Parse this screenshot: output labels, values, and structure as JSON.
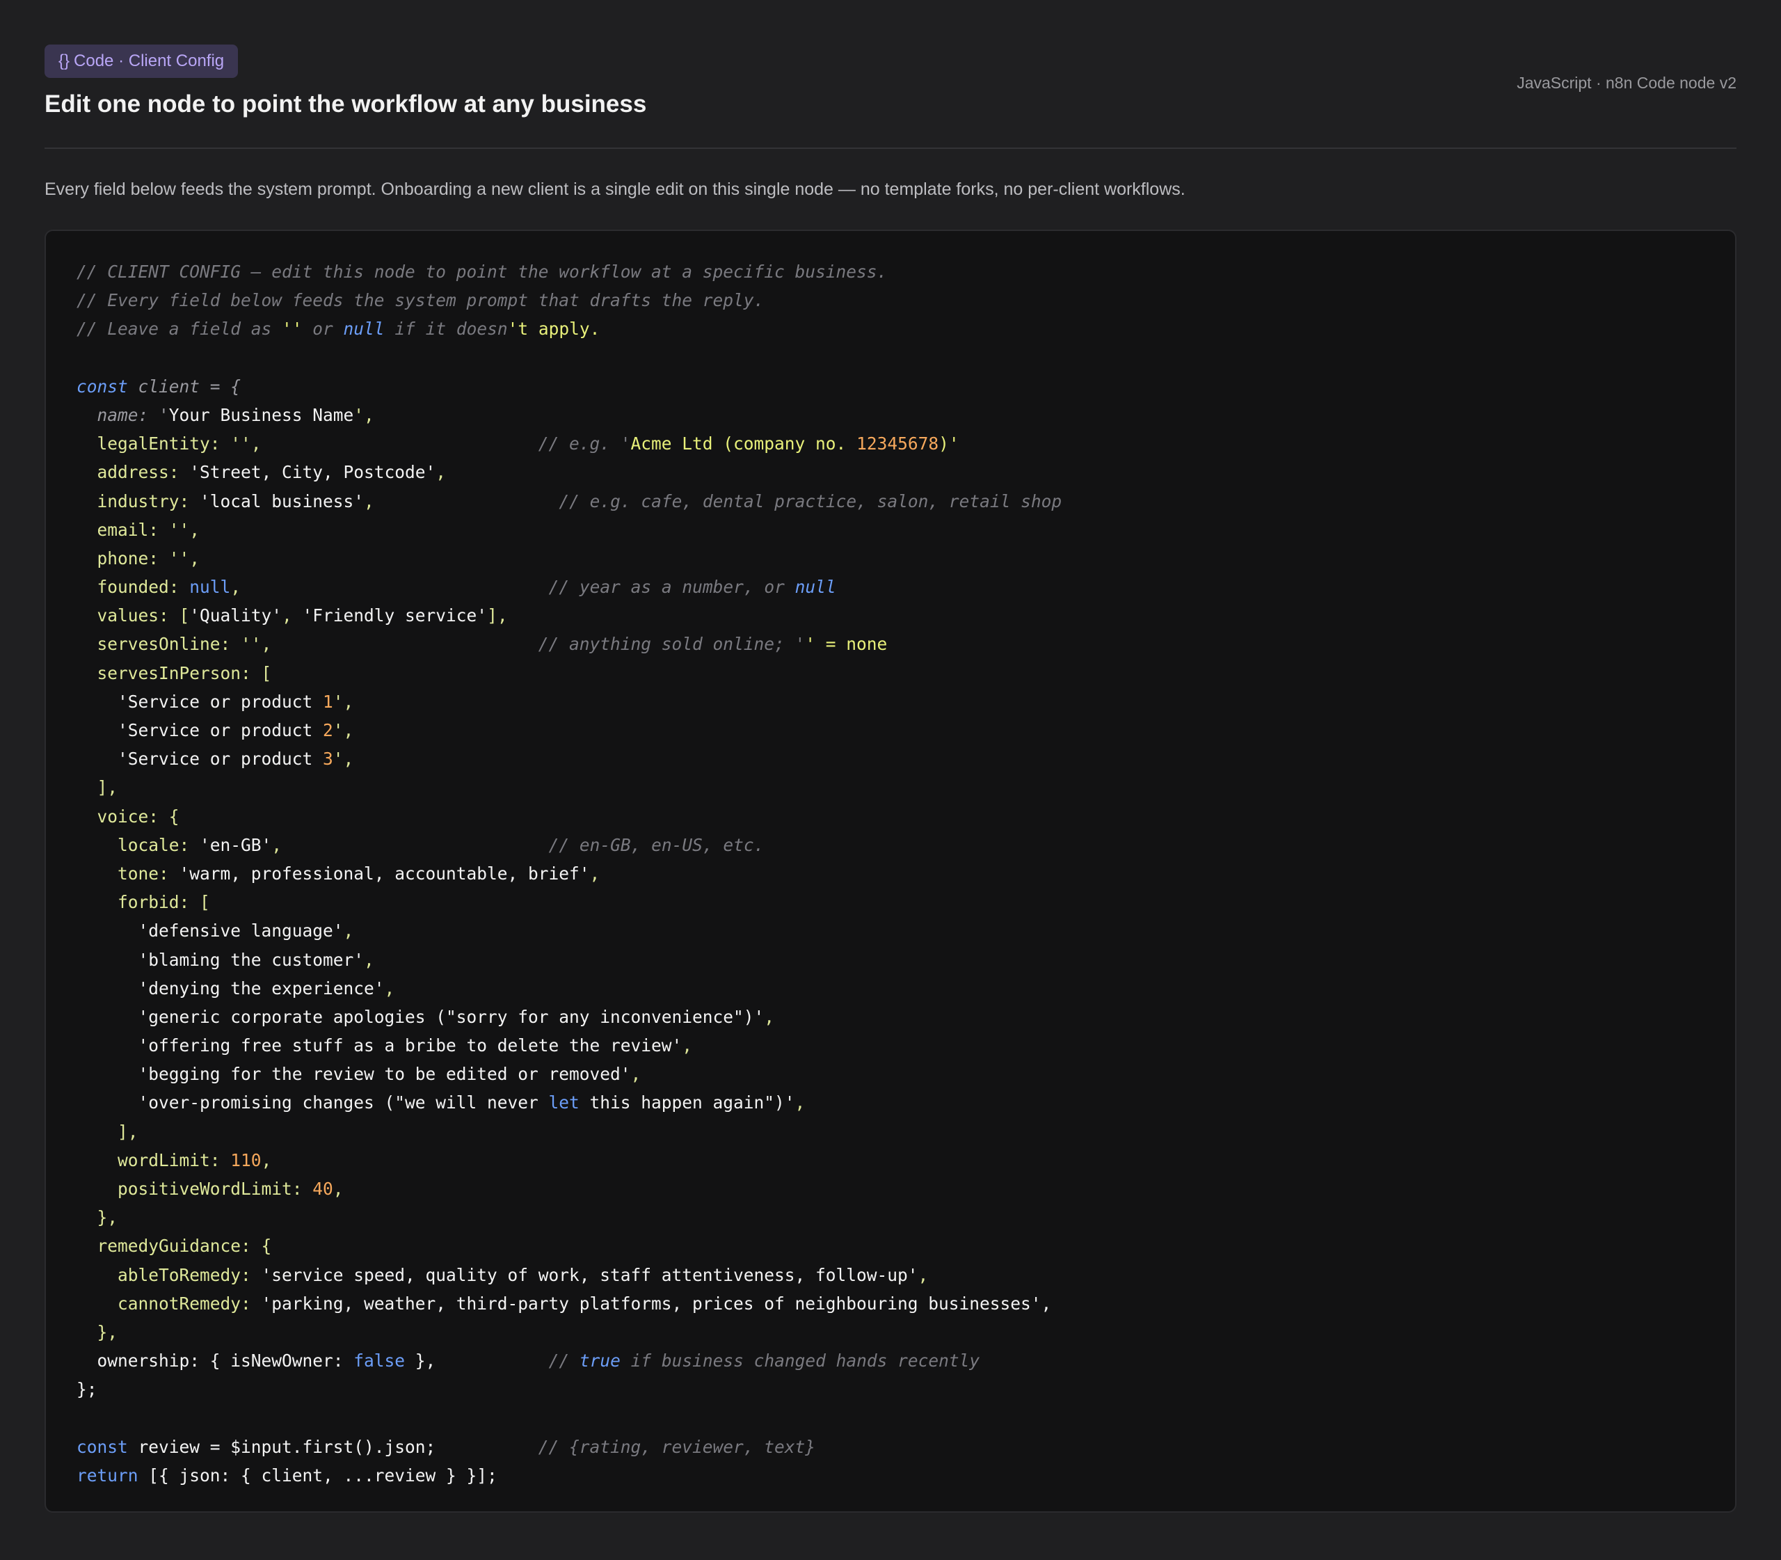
{
  "header": {
    "badge_icon": "{}",
    "badge_label": "Code · Client Config",
    "title": "Edit one node to point the workflow at any business",
    "meta": "JavaScript · n8n Code node v2"
  },
  "description": "Every field below feeds the system prompt. Onboarding a new client is a single edit on this single node — no template forks, no per-client workflows.",
  "code": {
    "language": "javascript",
    "lines": [
      [
        {
          "t": "cm",
          "v": "// CLIENT CONFIG — edit this node to point the workflow at a specific business."
        }
      ],
      [
        {
          "t": "cm",
          "v": "// Every field below feeds the system prompt that drafts the reply."
        }
      ],
      [
        {
          "t": "cm",
          "v": "// Leave a field as "
        },
        {
          "t": "hl",
          "v": "''"
        },
        {
          "t": "cm",
          "v": " or "
        },
        {
          "t": "kwi",
          "v": "null"
        },
        {
          "t": "cm",
          "v": " if it doesn"
        },
        {
          "t": "hl",
          "v": "'t apply."
        }
      ],
      [],
      [
        {
          "t": "kwi",
          "v": "const"
        },
        {
          "t": "id",
          "v": " client = {"
        }
      ],
      [
        {
          "t": "id",
          "v": "  name: '"
        },
        {
          "t": "str",
          "v": "Your Business Name"
        },
        {
          "t": "pn",
          "v": "',"
        }
      ],
      [
        {
          "t": "key",
          "v": "  legalEntity: '',"
        },
        {
          "t": "pad",
          "v": "                           "
        },
        {
          "t": "cm",
          "v": "// e.g. '"
        },
        {
          "t": "hl",
          "v": "Acme Ltd (company no. "
        },
        {
          "t": "num",
          "v": "12345678"
        },
        {
          "t": "hl",
          "v": ")'"
        }
      ],
      [
        {
          "t": "key",
          "v": "  address: "
        },
        {
          "t": "str",
          "v": "'Street, City, Postcode'"
        },
        {
          "t": "pn",
          "v": ","
        }
      ],
      [
        {
          "t": "key",
          "v": "  industry: "
        },
        {
          "t": "str",
          "v": "'local business'"
        },
        {
          "t": "pn",
          "v": ","
        },
        {
          "t": "pad",
          "v": "                  "
        },
        {
          "t": "cm",
          "v": "// e.g. cafe, dental practice, salon, retail shop"
        }
      ],
      [
        {
          "t": "key",
          "v": "  email: '',"
        }
      ],
      [
        {
          "t": "key",
          "v": "  phone: '',"
        }
      ],
      [
        {
          "t": "key",
          "v": "  founded: "
        },
        {
          "t": "kw",
          "v": "null"
        },
        {
          "t": "pn",
          "v": ","
        },
        {
          "t": "pad",
          "v": "                              "
        },
        {
          "t": "cm",
          "v": "// year as a number, or "
        },
        {
          "t": "kwi",
          "v": "null"
        }
      ],
      [
        {
          "t": "key",
          "v": "  values: ["
        },
        {
          "t": "str",
          "v": "'Quality'"
        },
        {
          "t": "pn",
          "v": ", "
        },
        {
          "t": "str",
          "v": "'Friendly service'"
        },
        {
          "t": "pn",
          "v": "],"
        }
      ],
      [
        {
          "t": "key",
          "v": "  servesOnline: '',"
        },
        {
          "t": "pad",
          "v": "                          "
        },
        {
          "t": "cm",
          "v": "// anything sold online; '"
        },
        {
          "t": "hl",
          "v": "' = none"
        }
      ],
      [
        {
          "t": "key",
          "v": "  servesInPerson: ["
        }
      ],
      [
        {
          "t": "str",
          "v": "    'Service or product "
        },
        {
          "t": "num",
          "v": "1"
        },
        {
          "t": "pn",
          "v": "',"
        }
      ],
      [
        {
          "t": "str",
          "v": "    'Service or product "
        },
        {
          "t": "num",
          "v": "2"
        },
        {
          "t": "pn",
          "v": "',"
        }
      ],
      [
        {
          "t": "str",
          "v": "    'Service or product "
        },
        {
          "t": "num",
          "v": "3"
        },
        {
          "t": "pn",
          "v": "',"
        }
      ],
      [
        {
          "t": "pn",
          "v": "  ],"
        }
      ],
      [
        {
          "t": "key",
          "v": "  voice: {"
        }
      ],
      [
        {
          "t": "key",
          "v": "    locale: "
        },
        {
          "t": "str",
          "v": "'en-GB'"
        },
        {
          "t": "pn",
          "v": ","
        },
        {
          "t": "pad",
          "v": "                          "
        },
        {
          "t": "cm",
          "v": "// en-GB, en-US, etc."
        }
      ],
      [
        {
          "t": "key",
          "v": "    tone: "
        },
        {
          "t": "str",
          "v": "'warm, professional, accountable, brief'"
        },
        {
          "t": "pn",
          "v": ","
        }
      ],
      [
        {
          "t": "key",
          "v": "    forbid: ["
        }
      ],
      [
        {
          "t": "str",
          "v": "      'defensive language'"
        },
        {
          "t": "pn",
          "v": ","
        }
      ],
      [
        {
          "t": "str",
          "v": "      'blaming the customer'"
        },
        {
          "t": "pn",
          "v": ","
        }
      ],
      [
        {
          "t": "str",
          "v": "      'denying the experience'"
        },
        {
          "t": "pn",
          "v": ","
        }
      ],
      [
        {
          "t": "str",
          "v": "      'generic corporate apologies (\"sorry for any inconvenience\")'"
        },
        {
          "t": "pn",
          "v": ","
        }
      ],
      [
        {
          "t": "str",
          "v": "      'offering free stuff as a bribe to delete the review'"
        },
        {
          "t": "pn",
          "v": ","
        }
      ],
      [
        {
          "t": "str",
          "v": "      'begging for the review to be edited or removed'"
        },
        {
          "t": "pn",
          "v": ","
        }
      ],
      [
        {
          "t": "str",
          "v": "      'over-promising changes (\"we will never "
        },
        {
          "t": "kw",
          "v": "let"
        },
        {
          "t": "str",
          "v": " this happen again\")'"
        },
        {
          "t": "pn",
          "v": ","
        }
      ],
      [
        {
          "t": "pn",
          "v": "    ],"
        }
      ],
      [
        {
          "t": "key",
          "v": "    wordLimit: "
        },
        {
          "t": "num",
          "v": "110"
        },
        {
          "t": "pn",
          "v": ","
        }
      ],
      [
        {
          "t": "key",
          "v": "    positiveWordLimit: "
        },
        {
          "t": "num",
          "v": "40"
        },
        {
          "t": "pn",
          "v": ","
        }
      ],
      [
        {
          "t": "pn",
          "v": "  },"
        }
      ],
      [
        {
          "t": "key",
          "v": "  remedyGuidance: {"
        }
      ],
      [
        {
          "t": "key",
          "v": "    ableToRemedy: "
        },
        {
          "t": "str",
          "v": "'service speed, quality of work, staff attentiveness, follow-up'"
        },
        {
          "t": "pn",
          "v": ","
        }
      ],
      [
        {
          "t": "key",
          "v": "    cannotRemedy: "
        },
        {
          "t": "str",
          "v": "'parking, weather, third-party platforms, prices of neighbouring businesses',"
        }
      ],
      [
        {
          "t": "pn",
          "v": "  },"
        }
      ],
      [
        {
          "t": "str",
          "v": "  ownership: { isNewOwner: "
        },
        {
          "t": "kw",
          "v": "false"
        },
        {
          "t": "str",
          "v": " },"
        },
        {
          "t": "pad",
          "v": "           "
        },
        {
          "t": "cm",
          "v": "// "
        },
        {
          "t": "kwi",
          "v": "true"
        },
        {
          "t": "cm",
          "v": " if business changed hands recently"
        }
      ],
      [
        {
          "t": "str",
          "v": "};"
        }
      ],
      [],
      [
        {
          "t": "kw",
          "v": "const"
        },
        {
          "t": "str",
          "v": " review = $input.first().json;"
        },
        {
          "t": "pad",
          "v": "          "
        },
        {
          "t": "cm",
          "v": "// {rating, reviewer, text}"
        }
      ],
      [
        {
          "t": "kw",
          "v": "return"
        },
        {
          "t": "str",
          "v": " [{ json: { client, ...review } }];"
        }
      ]
    ]
  }
}
